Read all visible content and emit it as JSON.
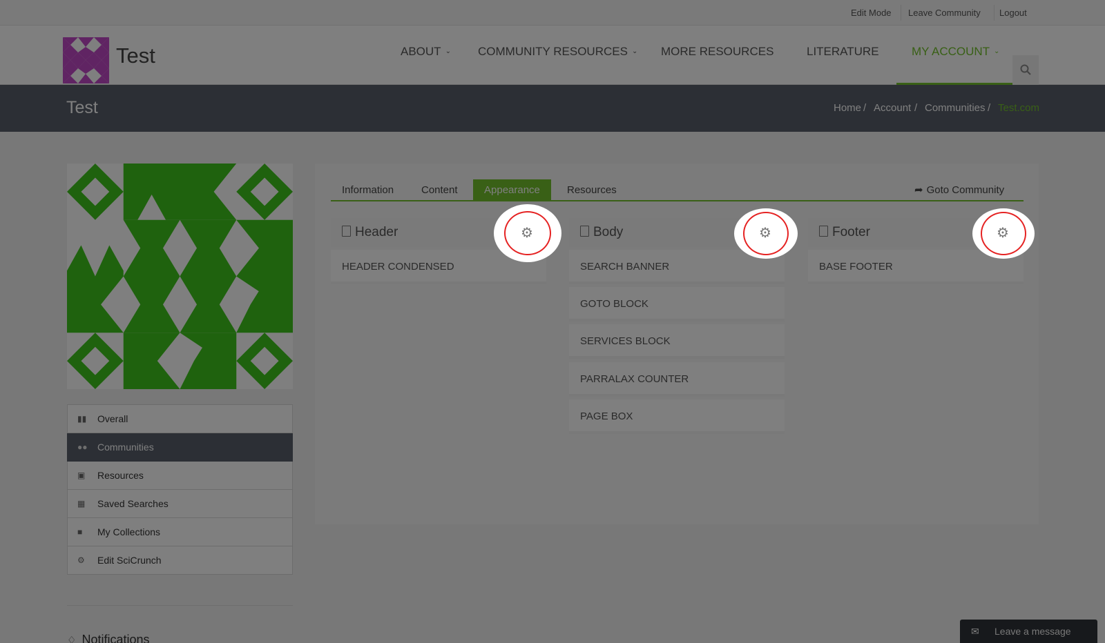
{
  "topbar": {
    "edit_mode": "Edit Mode",
    "leave_community": "Leave Community",
    "logout": "Logout"
  },
  "brand": {
    "name": "Test",
    "logo_color": "#c048c7"
  },
  "nav": {
    "about": "ABOUT",
    "community_resources": "COMMUNITY RESOURCES",
    "more_resources": "MORE RESOURCES",
    "literature": "LITERATURE",
    "my_account": "MY ACCOUNT",
    "active_color": "#72c02c"
  },
  "page": {
    "title": "Test",
    "breadcrumb": {
      "home": "Home",
      "account": "Account",
      "communities": "Communities",
      "current": "Test.com"
    }
  },
  "tabs": {
    "information": "Information",
    "content": "Content",
    "appearance": "Appearance",
    "resources": "Resources",
    "goto": "Goto Community"
  },
  "columns": {
    "header": {
      "title": "Header",
      "items": [
        "HEADER CONDENSED"
      ]
    },
    "body": {
      "title": "Body",
      "items": [
        "SEARCH BANNER",
        "GOTO BLOCK",
        "SERVICES BLOCK",
        "PARRALAX COUNTER",
        "PAGE BOX"
      ]
    },
    "footer": {
      "title": "Footer",
      "items": [
        "BASE FOOTER"
      ]
    }
  },
  "sidebar": {
    "items": [
      {
        "label": "Overall",
        "icon": "bar-chart-icon"
      },
      {
        "label": "Communities",
        "icon": "users-icon"
      },
      {
        "label": "Resources",
        "icon": "cubes-icon"
      },
      {
        "label": "Saved Searches",
        "icon": "floppy-icon"
      },
      {
        "label": "My Collections",
        "icon": "folder-open-icon"
      },
      {
        "label": "Edit SciCrunch",
        "icon": "gears-icon"
      }
    ],
    "active_index": 1,
    "notifications": "Notifications"
  },
  "chat": {
    "label": "Leave a message"
  },
  "colors": {
    "community_avatar": "#3fc51d",
    "highlight_ring": "#e52222",
    "dark_bar": "#585f6b"
  }
}
